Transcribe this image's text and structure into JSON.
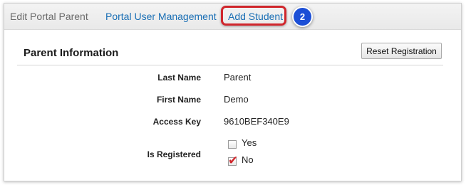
{
  "tabs": {
    "edit_portal_parent": "Edit Portal Parent",
    "portal_user_management": "Portal User Management",
    "add_student": "Add Student"
  },
  "callout": {
    "step_number": "2",
    "highlight_color": "#d0262c",
    "badge_color": "#1c4fd6"
  },
  "panel": {
    "title": "Parent Information",
    "reset_button_label": "Reset Registration"
  },
  "fields": {
    "last_name": {
      "label": "Last Name",
      "value": "Parent"
    },
    "first_name": {
      "label": "First Name",
      "value": "Demo"
    },
    "access_key": {
      "label": "Access Key",
      "value": "9610BEF340E9"
    },
    "is_registered": {
      "label": "Is Registered",
      "options": [
        {
          "label": "Yes",
          "checked": false
        },
        {
          "label": "No",
          "checked": true
        }
      ]
    }
  }
}
